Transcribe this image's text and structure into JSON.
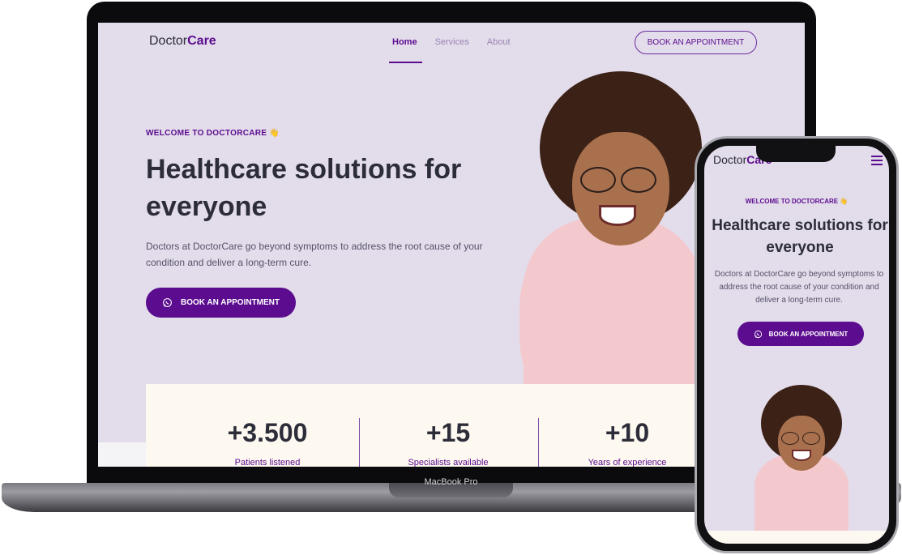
{
  "laptop": {
    "brand_label": "MacBook Pro",
    "site": {
      "logo_regular": "Doctor",
      "logo_bold": "Care",
      "nav": [
        {
          "label": "Home",
          "active": true
        },
        {
          "label": "Services",
          "active": false
        },
        {
          "label": "About",
          "active": false
        }
      ],
      "header_cta": "BOOK AN APPOINTMENT",
      "welcome": "WELCOME TO DOCTORCARE 👋",
      "title": "Healthcare solutions for everyone",
      "description": "Doctors at DoctorCare go beyond symptoms to address the root cause of your condition and deliver a long-term cure.",
      "cta_button": "BOOK AN APPOINTMENT",
      "cta_icon": "whatsapp-icon",
      "stats": [
        {
          "number": "+3.500",
          "label": "Patients listened"
        },
        {
          "number": "+15",
          "label": "Specialists available"
        },
        {
          "number": "+10",
          "label": "Years of experience"
        }
      ]
    }
  },
  "phone": {
    "site": {
      "logo_regular": "Doctor",
      "logo_bold": "Care",
      "menu_icon": "hamburger-menu-icon",
      "welcome": "WELCOME TO DOCTORCARE 👋",
      "title": "Healthcare solutions for everyone",
      "description": "Doctors at DoctorCare go beyond symptoms to address the root cause of your condition and deliver a long-term cure.",
      "cta_button": "BOOK AN APPOINTMENT",
      "cta_icon": "whatsapp-icon"
    }
  },
  "colors": {
    "brand_purple": "#5b0c8f",
    "background": "#e3dcea",
    "stats_background": "#fdf9f0",
    "text_dark": "#2d2d3a"
  }
}
